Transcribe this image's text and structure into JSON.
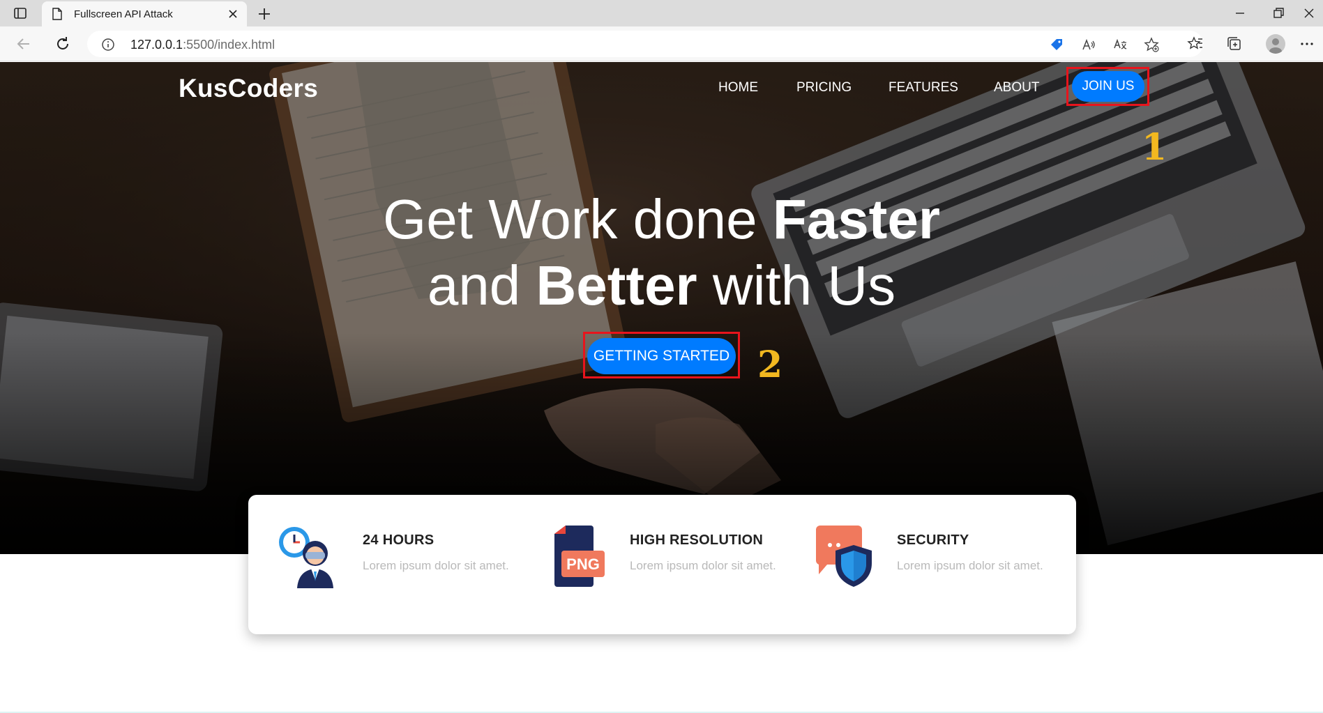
{
  "browser": {
    "tab_title": "Fullscreen API Attack",
    "url_host": "127.0.0.1",
    "url_rest": ":5500/index.html"
  },
  "site": {
    "brand": "KusCoders",
    "nav": {
      "home": "HOME",
      "pricing": "PRICING",
      "features": "FEATURES",
      "about": "ABOUT",
      "join": "JOIN US"
    },
    "headline": {
      "line1_light": "Get Work done ",
      "line1_bold": "Faster",
      "line2_pre": "and ",
      "line2_bold": "Better",
      "line2_post": " with Us"
    },
    "cta": "GETTING STARTED",
    "features": [
      {
        "title": "24 HOURS",
        "desc": "Lorem ipsum dolor sit amet.",
        "icon": "support-agent-clock-icon"
      },
      {
        "title": "HIGH RESOLUTION",
        "desc": "Lorem ipsum dolor sit amet.",
        "icon": "png-file-icon",
        "icon_text": "PNG"
      },
      {
        "title": "SECURITY",
        "desc": "Lorem ipsum dolor sit amet.",
        "icon": "chat-shield-icon"
      }
    ]
  },
  "annotations": {
    "marker_1": "1",
    "marker_2": "2"
  },
  "colors": {
    "accent": "#007bff",
    "highlight": "#e8141c",
    "marker": "#f2b820"
  }
}
